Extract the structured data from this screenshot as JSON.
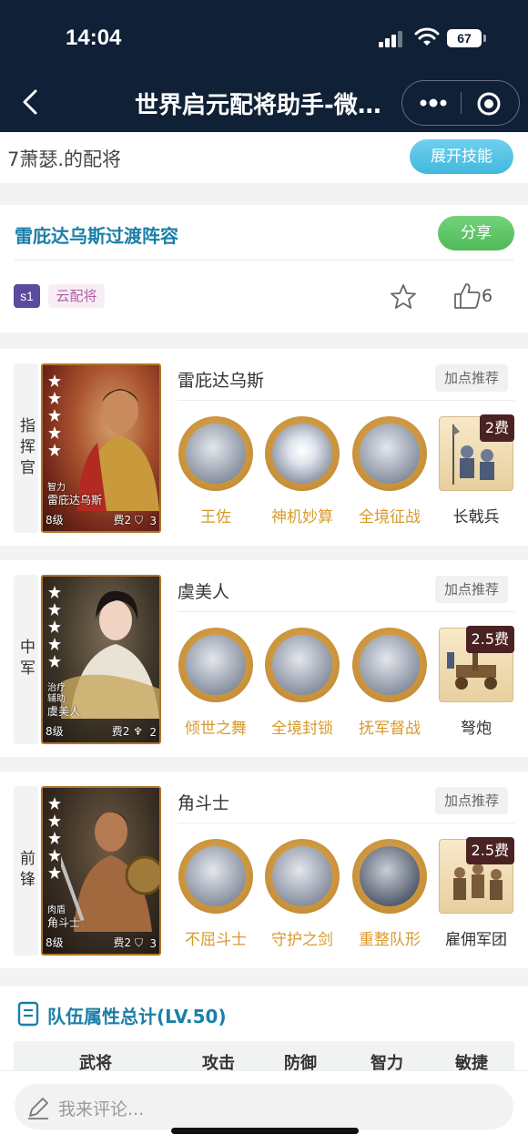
{
  "status_bar": {
    "time": "14:04",
    "battery": "67"
  },
  "nav": {
    "title": "世界启元配将助手-微…"
  },
  "user": {
    "name": "7萧瑟.的配将",
    "expand_label": "展开技能"
  },
  "team": {
    "title": "雷庇达乌斯过渡阵容",
    "share_label": "分享",
    "season_tag": "s1",
    "type_tag": "云配将",
    "likes": "6"
  },
  "heroes": [
    {
      "role": "指挥官",
      "name": "雷庇达乌斯",
      "points_label": "加点推荐",
      "tag": "智力",
      "portrait_name": "雷庇达乌斯",
      "level": "8级",
      "cost": "费2",
      "troop_count": "3",
      "stars": 5,
      "skills": [
        "王佐",
        "神机妙算",
        "全境征战"
      ],
      "troop": {
        "name": "长戟兵",
        "cost": "2费"
      }
    },
    {
      "role": "中军",
      "name": "虞美人",
      "points_label": "加点推荐",
      "tag": "治疗\n辅助",
      "portrait_name": "虞美人",
      "level": "8级",
      "cost": "费2",
      "troop_count": "2",
      "stars": 5,
      "skills": [
        "倾世之舞",
        "全境封锁",
        "抚军督战"
      ],
      "troop": {
        "name": "弩炮",
        "cost": "2.5费"
      }
    },
    {
      "role": "前锋",
      "name": "角斗士",
      "points_label": "加点推荐",
      "tag": "肉盾",
      "portrait_name": "角斗士",
      "level": "8级",
      "cost": "费2",
      "troop_count": "3",
      "stars": 5,
      "skills": [
        "不屈斗士",
        "守护之剑",
        "重整队形"
      ],
      "troop": {
        "name": "雇佣军团",
        "cost": "2.5费"
      }
    }
  ],
  "stats": {
    "title": "队伍属性总计(LV.50)",
    "columns": [
      "武将",
      "攻击",
      "防御",
      "智力",
      "敏捷"
    ]
  },
  "comment": {
    "placeholder": "我来评论..."
  },
  "colors": {
    "nav_bg": "#102036",
    "accent_blue": "#1b7fa8",
    "skill_gold": "#d89a2e",
    "share_green": "#4fba57"
  }
}
